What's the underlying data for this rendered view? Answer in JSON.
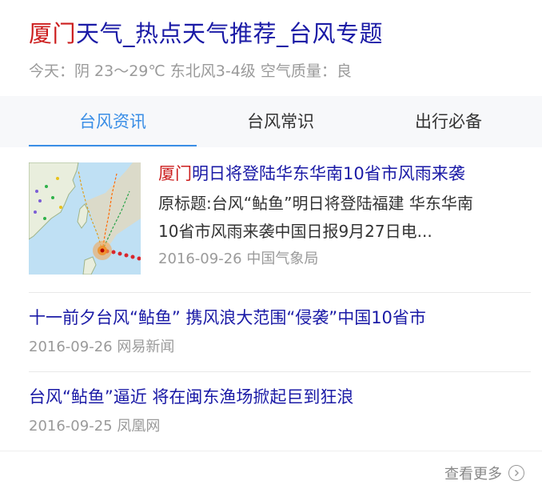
{
  "title": {
    "highlight": "厦门",
    "rest": "天气_热点天气推荐_台风专题"
  },
  "weather_line": "今天：阴 23～29℃ 东北风3-4级 空气质量：良",
  "tabs": [
    {
      "label": "台风资讯",
      "active": true
    },
    {
      "label": "台风常识",
      "active": false
    },
    {
      "label": "出行必备",
      "active": false
    }
  ],
  "news": [
    {
      "headline_highlight": "厦门",
      "headline_rest": "明日将登陆华东华南10省市风雨来袭",
      "summary_lines": [
        "原标题:台风“鲇鱼”明日将登陆福建 华东华南",
        "10省市风雨来袭中国日报9月27日电..."
      ],
      "date": "2016-09-26",
      "source": "中国气象局",
      "thumbnail": "typhoon-track-map"
    },
    {
      "headline": "十一前夕台风“鲇鱼” 携风浪大范围“侵袭”中国10省市",
      "date": "2016-09-26",
      "source": "网易新闻"
    },
    {
      "headline": "台风“鲇鱼”逼近 将在闽东渔场掀起巨到狂浪",
      "date": "2016-09-25",
      "source": "凤凰网"
    }
  ],
  "more": {
    "label": "查看更多"
  },
  "colors": {
    "highlight": "#cc1d1d",
    "link": "#1a1aa6",
    "accent": "#3a8ee6",
    "muted": "#9a9a9a"
  }
}
